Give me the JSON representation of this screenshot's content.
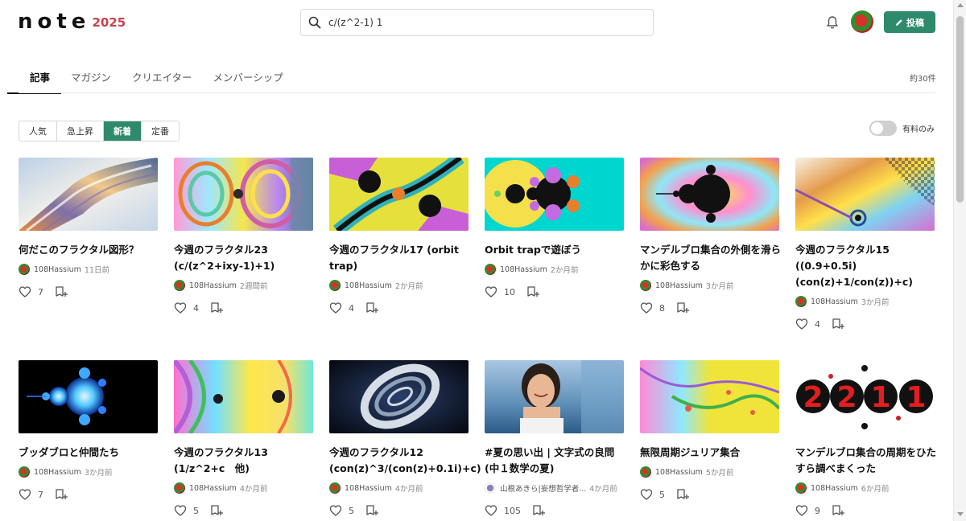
{
  "header": {
    "logo_text": "note",
    "logo_badge": "2025",
    "search_value": "c/(z^2-1) 1",
    "post_label": "投稿",
    "brand_color": "#2e8a6a"
  },
  "tabs": [
    {
      "label": "記事"
    },
    {
      "label": "マガジン"
    },
    {
      "label": "クリエイター"
    },
    {
      "label": "メンバーシップ"
    }
  ],
  "result_count": "約30件",
  "sorts": [
    {
      "label": "人気"
    },
    {
      "label": "急上昇"
    },
    {
      "label": "新着"
    },
    {
      "label": "定番"
    }
  ],
  "paid_only_label": "有料のみ",
  "cards": [
    {
      "title": "何だこのフラクタル図形？",
      "author": "108Hassium",
      "date": "11日前",
      "likes": "7"
    },
    {
      "title": "今週のフラクタル23 (c/(z^2+ixy-1)+1)",
      "author": "108Hassium",
      "date": "2週間前",
      "likes": "4"
    },
    {
      "title": "今週のフラクタル17 (orbit trap)",
      "author": "108Hassium",
      "date": "2か月前",
      "likes": "4"
    },
    {
      "title": "Orbit trapで遊ぼう",
      "author": "108Hassium",
      "date": "2か月前",
      "likes": "10"
    },
    {
      "title": "マンデルブロ集合の外側を滑らかに彩色する",
      "author": "108Hassium",
      "date": "3か月前",
      "likes": "8"
    },
    {
      "title": "今週のフラクタル15 ((0.9+0.5i)(con(z)+1/con(z))+c)",
      "author": "108Hassium",
      "date": "3か月前",
      "likes": "4"
    },
    {
      "title": "ブッダブロと仲間たち",
      "author": "108Hassium",
      "date": "3か月前",
      "likes": "7"
    },
    {
      "title": "今週のフラクタル13 (1/z^2+c　他)",
      "author": "108Hassium",
      "date": "4か月前",
      "likes": "5"
    },
    {
      "title": "今週のフラクタル12 (con(z)^3/(con(z)+0.1i)+c)",
      "author": "108Hassium",
      "date": "4か月前",
      "likes": "5"
    },
    {
      "title": "#夏の思い出 | 文字式の良問(中１数学の夏)",
      "author": "山根あきら|妄想哲学者...",
      "date": "4か月前",
      "likes": "105"
    },
    {
      "title": "無限周期ジュリア集合",
      "author": "108Hassium",
      "date": "5か月前",
      "likes": "5"
    },
    {
      "title": "マンデルブロ集合の周期をひたすら調べまくった",
      "author": "108Hassium",
      "date": "6か月前",
      "likes": "9"
    }
  ],
  "thumb12_text": [
    "2",
    "2",
    "1",
    "1"
  ]
}
